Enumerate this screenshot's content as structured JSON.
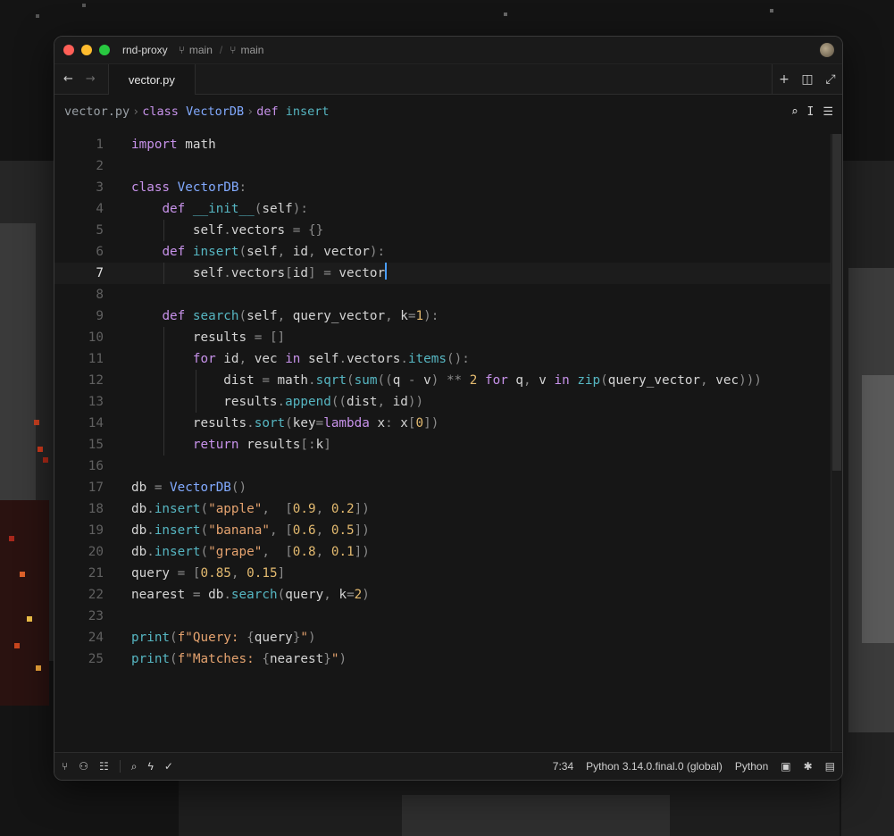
{
  "window": {
    "project": "rnd-proxy",
    "branch_primary": "main",
    "branch_secondary": "main"
  },
  "tab": {
    "label": "vector.py"
  },
  "breadcrumbs": {
    "file": "vector.py",
    "class_kw": "class",
    "class_name": "VectorDB",
    "def_kw": "def",
    "fn_name": "insert"
  },
  "editor": {
    "current_line": 7,
    "line_numbers": [
      "1",
      "2",
      "3",
      "4",
      "5",
      "6",
      "7",
      "8",
      "9",
      "10",
      "11",
      "12",
      "13",
      "14",
      "15",
      "16",
      "17",
      "18",
      "19",
      "20",
      "21",
      "22",
      "23",
      "24",
      "25"
    ]
  },
  "status": {
    "position": "7:34",
    "interpreter": "Python 3.14.0.final.0 (global)",
    "language": "Python"
  },
  "icons": {
    "back": "arrow-left-icon",
    "forward": "arrow-right-icon",
    "new_tab": "plus-icon",
    "split": "split-pane-icon",
    "maximize": "maximize-icon",
    "search": "search-icon",
    "cursor_tool": "text-cursor-icon",
    "settings": "sliders-icon"
  },
  "colors": {
    "keyword": "#c792ea",
    "class": "#82aaff",
    "function": "#56b6c2",
    "string": "#e5a36f",
    "number": "#e2b96f",
    "cursor": "#4a9eff"
  }
}
